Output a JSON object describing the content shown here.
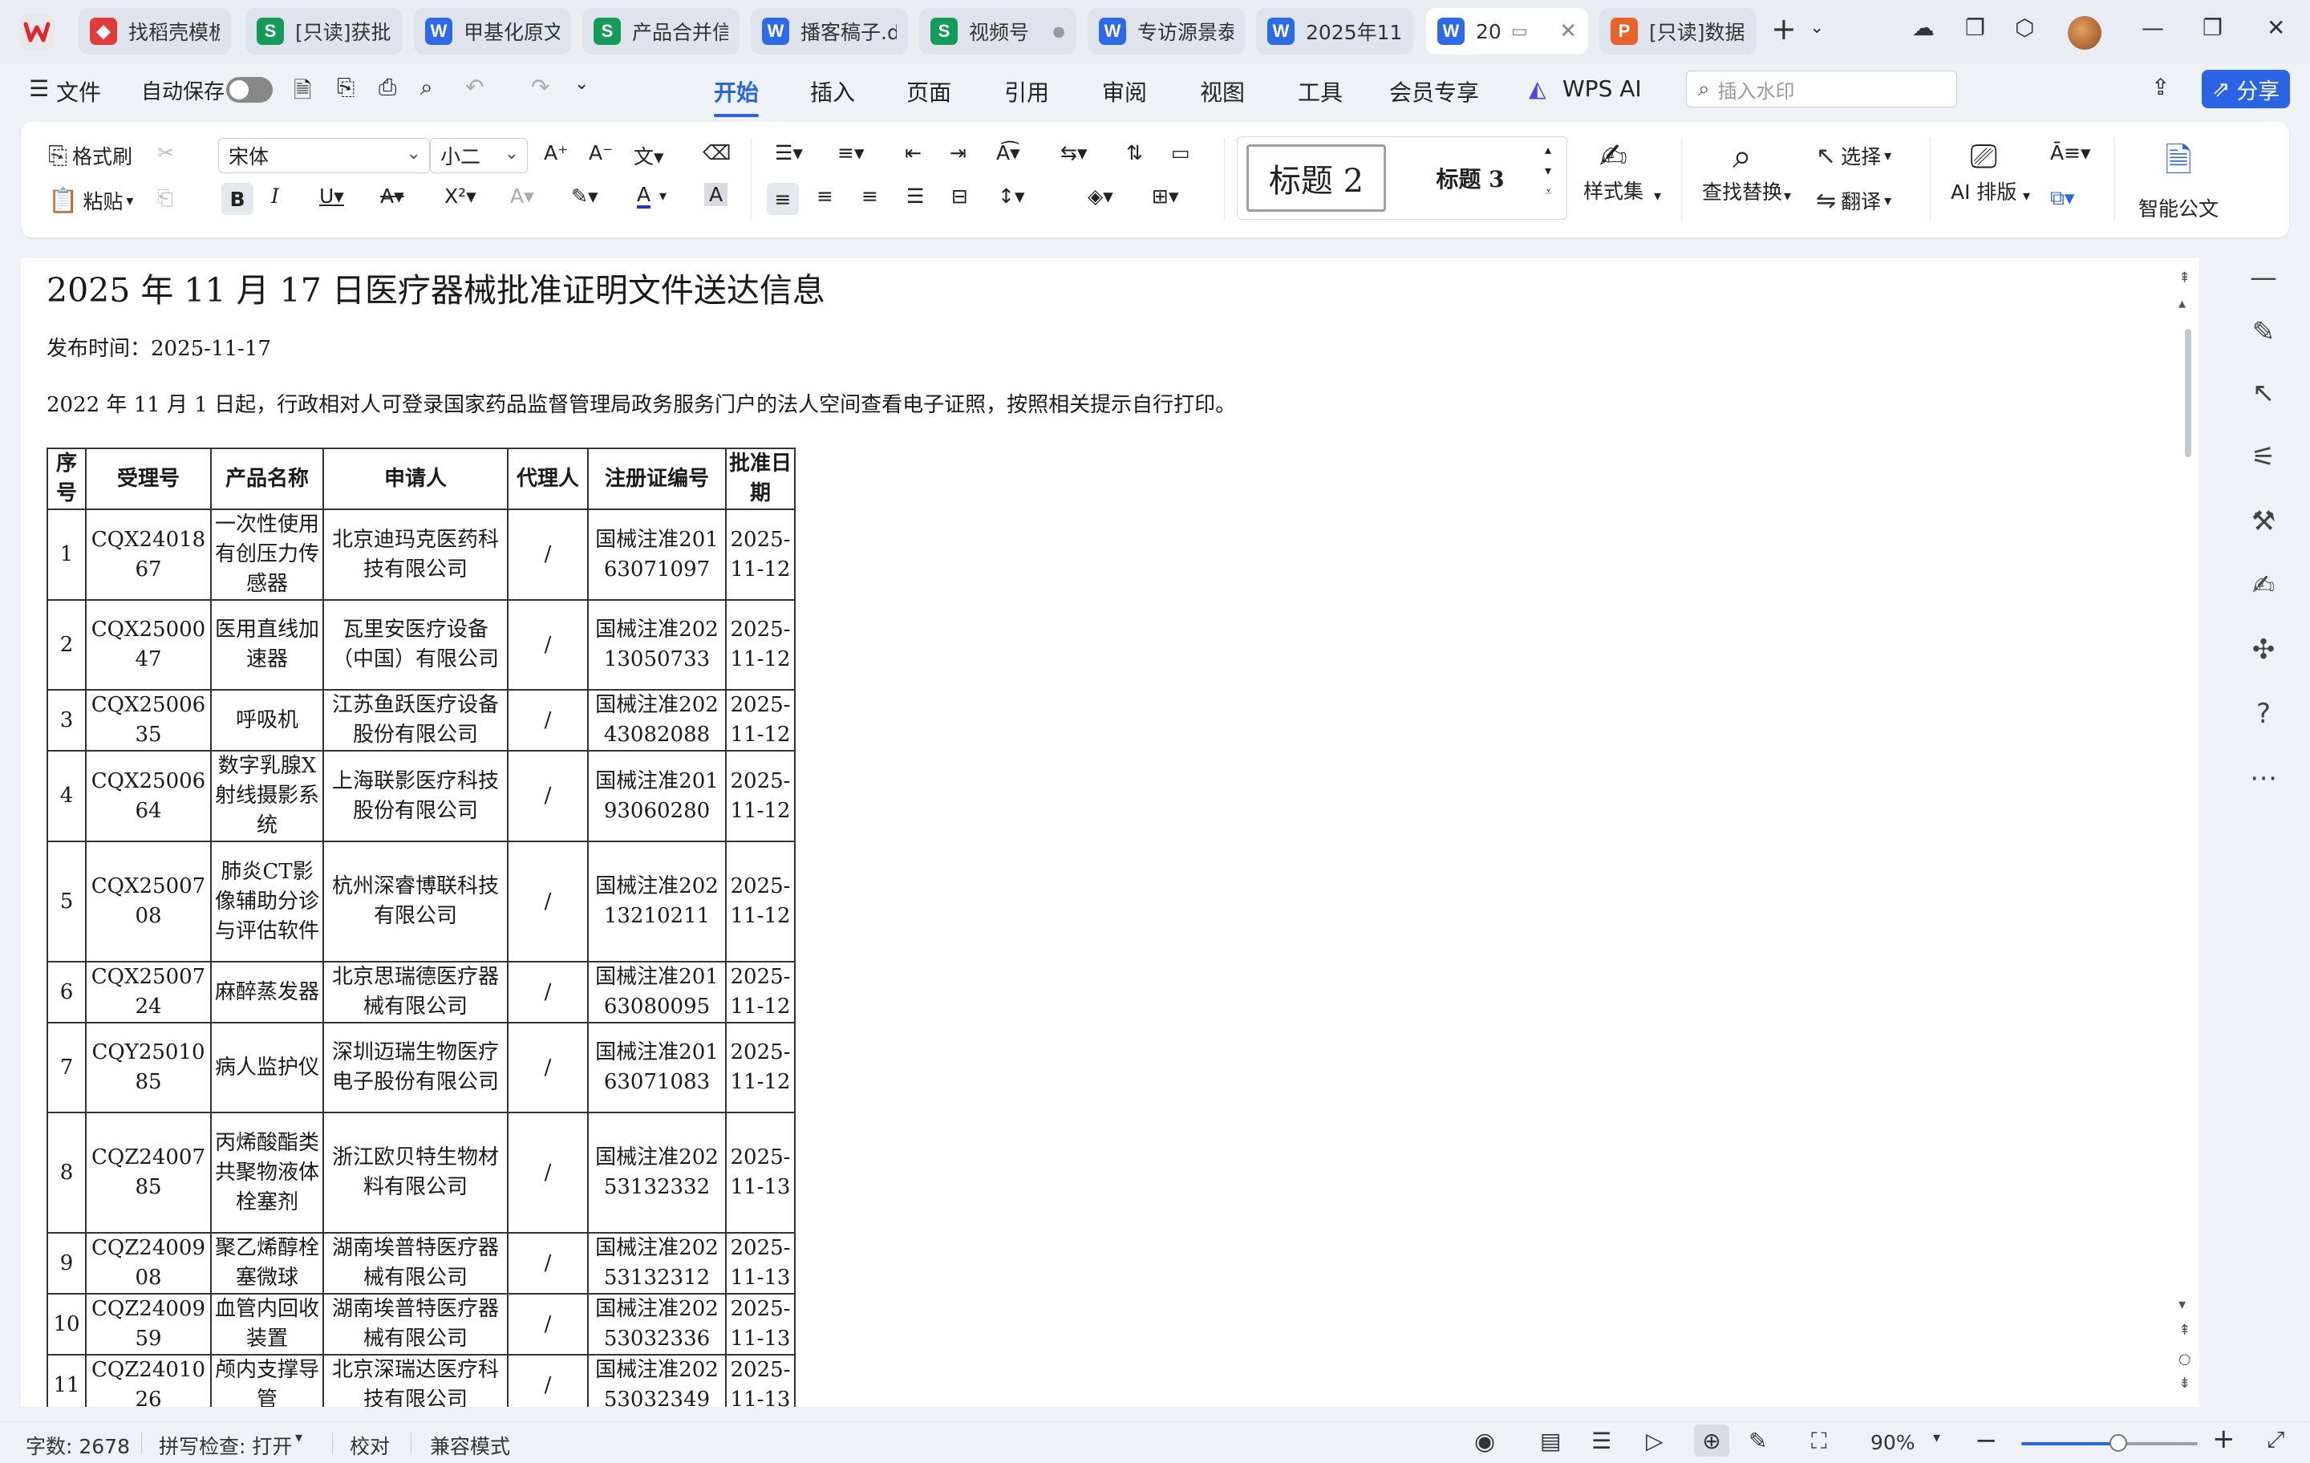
{
  "tabs": [
    {
      "label": "找稻壳模板",
      "type": "R",
      "active": false
    },
    {
      "label": "[只读]获批…",
      "type": "S",
      "active": false
    },
    {
      "label": "甲基化原文",
      "type": "W",
      "active": false
    },
    {
      "label": "产品合并信",
      "type": "S",
      "active": false
    },
    {
      "label": "播客稿子.d",
      "type": "W",
      "active": false
    },
    {
      "label": "视频号",
      "type": "S",
      "active": false
    },
    {
      "label": "专访源景泰",
      "type": "W",
      "active": false
    },
    {
      "label": "2025年11月",
      "type": "W",
      "active": false
    },
    {
      "label": "20",
      "type": "W",
      "active": true
    },
    {
      "label": "[只读]数据",
      "type": "P",
      "active": false
    }
  ],
  "menubar": {
    "file": "文件",
    "autosave": "自动保存",
    "items": [
      "开始",
      "插入",
      "页面",
      "引用",
      "审阅",
      "视图",
      "工具",
      "会员专享"
    ],
    "active": "开始",
    "wps_ai": "WPS AI",
    "watermark_placeholder": "插入水印",
    "share": "分享"
  },
  "ribbon": {
    "format_painter": "格式刷",
    "paste": "粘贴",
    "font_name": "宋体",
    "font_size": "小二",
    "heading2": "标题 2",
    "heading3": "标题 3",
    "style_set": "样式集",
    "find_replace": "查找替换",
    "select": "选择",
    "translate": "翻译",
    "ai_layout": "AI 排版",
    "smart_doc": "智能公文"
  },
  "document": {
    "title": "2025 年 11 月 17 日医疗器械批准证明文件送达信息",
    "published": "发布时间：2025-11-17",
    "note": "2022 年 11 月 1 日起，行政相对人可登录国家药品监督管理局政务服务门户的法人空间查看电子证照，按照相关提示自行打印。",
    "headers": [
      "序号",
      "受理号",
      "产品名称",
      "申请人",
      "代理人",
      "注册证编号",
      "批准日期"
    ],
    "rows": [
      [
        "1",
        "CQX2401867",
        "一次性使用有创压力传感器",
        "北京迪玛克医药科技有限公司",
        "/",
        "国械注准20163071097",
        "2025-11-12"
      ],
      [
        "2",
        "CQX2500047",
        "医用直线加速器",
        "瓦里安医疗设备（中国）有限公司",
        "/",
        "国械注准20213050733",
        "2025-11-12"
      ],
      [
        "3",
        "CQX2500635",
        "呼吸机",
        "江苏鱼跃医疗设备股份有限公司",
        "/",
        "国械注准20243082088",
        "2025-11-12"
      ],
      [
        "4",
        "CQX2500664",
        "数字乳腺X射线摄影系统",
        "上海联影医疗科技股份有限公司",
        "/",
        "国械注准20193060280",
        "2025-11-12"
      ],
      [
        "5",
        "CQX2500708",
        "肺炎CT影像辅助分诊与评估软件",
        "杭州深睿博联科技有限公司",
        "/",
        "国械注准20213210211",
        "2025-11-12"
      ],
      [
        "6",
        "CQX2500724",
        "麻醉蒸发器",
        "北京思瑞德医疗器械有限公司",
        "/",
        "国械注准20163080095",
        "2025-11-12"
      ],
      [
        "7",
        "CQY2501085",
        "病人监护仪",
        "深圳迈瑞生物医疗电子股份有限公司",
        "/",
        "国械注准20163071083",
        "2025-11-12"
      ],
      [
        "8",
        "CQZ2400785",
        "丙烯酸酯类共聚物液体栓塞剂",
        "浙江欧贝特生物材料有限公司",
        "/",
        "国械注准20253132332",
        "2025-11-13"
      ],
      [
        "9",
        "CQZ2400908",
        "聚乙烯醇栓塞微球",
        "湖南埃普特医疗器械有限公司",
        "/",
        "国械注准20253132312",
        "2025-11-13"
      ],
      [
        "10",
        "CQZ2400959",
        "血管内回收装置",
        "湖南埃普特医疗器械有限公司",
        "/",
        "国械注准20253032336",
        "2025-11-13"
      ],
      [
        "11",
        "CQZ2401026",
        "颅内支撑导管",
        "北京深瑞达医疗科技有限公司",
        "/",
        "国械注准20253032349",
        "2025-11-13"
      ]
    ]
  },
  "statusbar": {
    "word_count": "字数: 2678",
    "spell_check": "拼写检查: 打开",
    "proofread": "校对",
    "compat_mode": "兼容模式",
    "zoom": "90%",
    "zoom_level": 0.55
  }
}
